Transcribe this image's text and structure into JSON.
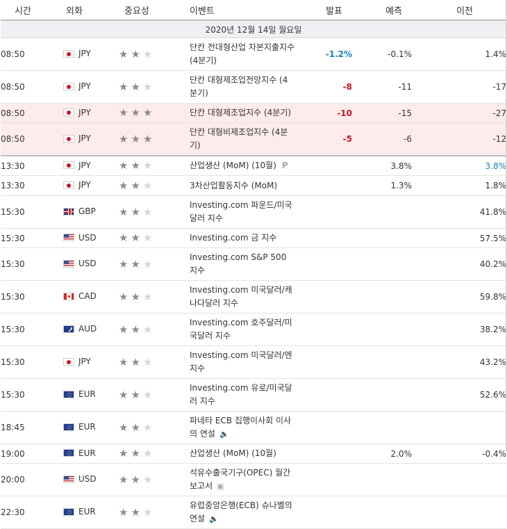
{
  "headers": {
    "time": "시간",
    "currency": "외화",
    "importance": "중요성",
    "event": "이벤트",
    "actual": "발표",
    "forecast": "예측",
    "previous": "이전"
  },
  "day_label": "2020년 12월 14일 월요일",
  "rows": [
    {
      "time": "08:50",
      "currency": "JPY",
      "flag": "jpy",
      "stars": 2,
      "event": "단칸 전대형산업 자본지출지수 (4분기)",
      "actual": "-1.2%",
      "actual_color": "blue",
      "forecast": "-0.1%",
      "previous": "1.4%",
      "highlight": false
    },
    {
      "time": "08:50",
      "currency": "JPY",
      "flag": "jpy",
      "stars": 2,
      "event": "단칸 대형제조업전망지수 (4분기)",
      "actual": "-8",
      "actual_color": "red",
      "forecast": "-11",
      "previous": "-17",
      "highlight": false
    },
    {
      "time": "08:50",
      "currency": "JPY",
      "flag": "jpy",
      "stars": 3,
      "event": "단칸 대형제조업지수 (4분기)",
      "actual": "-10",
      "actual_color": "red",
      "forecast": "-15",
      "previous": "-27",
      "highlight": true
    },
    {
      "time": "08:50",
      "currency": "JPY",
      "flag": "jpy",
      "stars": 3,
      "event": "단칸 대형비제조업지수 (4분기)",
      "actual": "-5",
      "actual_color": "red",
      "forecast": "-6",
      "previous": "-12",
      "highlight": true,
      "separator": true
    },
    {
      "time": "13:30",
      "currency": "JPY",
      "flag": "jpy",
      "stars": 2,
      "event": "산업생산 (MoM) (10월)",
      "badge": "P",
      "actual": "",
      "forecast": "3.8%",
      "previous": "3.8%",
      "previous_color": "blue"
    },
    {
      "time": "13:30",
      "currency": "JPY",
      "flag": "jpy",
      "stars": 2,
      "event": "3차산업활동지수 (MoM)",
      "actual": "",
      "forecast": "1.3%",
      "previous": "1.8%"
    },
    {
      "time": "15:30",
      "currency": "GBP",
      "flag": "gbp",
      "stars": 2,
      "event": "Investing.com 파운드/미국달러 지수",
      "actual": "",
      "forecast": "",
      "previous": "41.8%"
    },
    {
      "time": "15:30",
      "currency": "USD",
      "flag": "usd",
      "stars": 2,
      "event": "Investing.com 금 지수",
      "actual": "",
      "forecast": "",
      "previous": "57.5%"
    },
    {
      "time": "15:30",
      "currency": "USD",
      "flag": "usd",
      "stars": 2,
      "event": "Investing.com S&P 500 지수",
      "actual": "",
      "forecast": "",
      "previous": "40.2%"
    },
    {
      "time": "15:30",
      "currency": "CAD",
      "flag": "cad",
      "stars": 2,
      "event": "Investing.com 미국달러/캐나다달러 지수",
      "actual": "",
      "forecast": "",
      "previous": "59.8%"
    },
    {
      "time": "15:30",
      "currency": "AUD",
      "flag": "aud",
      "stars": 2,
      "event": "Investing.com 호주달러/미국달러 지수",
      "actual": "",
      "forecast": "",
      "previous": "38.2%"
    },
    {
      "time": "15:30",
      "currency": "JPY",
      "flag": "jpy",
      "stars": 2,
      "event": "Investing.com 미국달러/엔 지수",
      "actual": "",
      "forecast": "",
      "previous": "43.2%"
    },
    {
      "time": "15:30",
      "currency": "EUR",
      "flag": "eur",
      "stars": 2,
      "event": "Investing.com 유로/미국달러 지수",
      "actual": "",
      "forecast": "",
      "previous": "52.6%"
    },
    {
      "time": "18:45",
      "currency": "EUR",
      "flag": "eur",
      "stars": 2,
      "event": "파네타 ECB 집행이사회 이사의 연설",
      "icon": "speaker-icon",
      "actual": "",
      "forecast": "",
      "previous": ""
    },
    {
      "time": "19:00",
      "currency": "EUR",
      "flag": "eur",
      "stars": 2,
      "event": "산업생산 (MoM) (10월)",
      "actual": "",
      "forecast": "2.0%",
      "previous": "-0.4%"
    },
    {
      "time": "20:00",
      "currency": "USD",
      "flag": "usd",
      "stars": 2,
      "event": "석유수출국기구(OPEC) 월간 보고서",
      "icon": "document-icon",
      "actual": "",
      "forecast": "",
      "previous": ""
    },
    {
      "time": "22:30",
      "currency": "EUR",
      "flag": "eur",
      "stars": 2,
      "event": "유럽중앙은행(ECB) 슈나벨의 연설",
      "icon": "speaker-icon",
      "actual": "",
      "forecast": "",
      "previous": ""
    }
  ]
}
